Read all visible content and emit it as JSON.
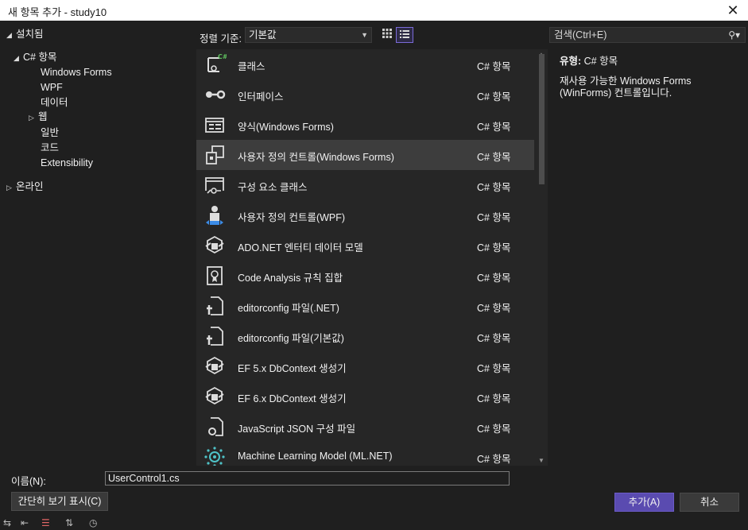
{
  "window": {
    "title": "새 항목 추가 - study10",
    "close_icon": "close-icon"
  },
  "tree": {
    "installed": "설치됨",
    "csharp_items": "C# 항목",
    "children": [
      "Windows Forms",
      "WPF",
      "데이터",
      "웹",
      "일반",
      "코드",
      "Extensibility"
    ],
    "online": "온라인"
  },
  "sort": {
    "label": "정렬 기준:",
    "value": "기본값"
  },
  "search": {
    "placeholder": "검색(Ctrl+E)"
  },
  "templates": [
    {
      "name": "클래스",
      "type": "C# 항목",
      "icon": "class-icon"
    },
    {
      "name": "인터페이스",
      "type": "C# 항목",
      "icon": "interface-icon"
    },
    {
      "name": "양식(Windows Forms)",
      "type": "C# 항목",
      "icon": "form-icon"
    },
    {
      "name": "사용자 정의 컨트롤(Windows Forms)",
      "type": "C# 항목",
      "icon": "user-control-icon"
    },
    {
      "name": "구성 요소 클래스",
      "type": "C# 항목",
      "icon": "component-class-icon"
    },
    {
      "name": "사용자 정의 컨트롤(WPF)",
      "type": "C# 항목",
      "icon": "wpf-user-control-icon"
    },
    {
      "name": "ADO.NET 엔터티 데이터 모델",
      "type": "C# 항목",
      "icon": "entity-model-icon"
    },
    {
      "name": "Code Analysis 규칙 집합",
      "type": "C# 항목",
      "icon": "ruleset-icon"
    },
    {
      "name": "editorconfig 파일(.NET)",
      "type": "C# 항목",
      "icon": "editorconfig-icon"
    },
    {
      "name": "editorconfig 파일(기본값)",
      "type": "C# 항목",
      "icon": "editorconfig-icon"
    },
    {
      "name": "EF 5.x DbContext 생성기",
      "type": "C# 항목",
      "icon": "dbcontext-generator-icon"
    },
    {
      "name": "EF 6.x DbContext 생성기",
      "type": "C# 항목",
      "icon": "dbcontext-generator-icon"
    },
    {
      "name": "JavaScript JSON 구성 파일",
      "type": "C# 항목",
      "icon": "json-config-icon"
    },
    {
      "name": "Machine Learning Model (ML.NET)",
      "type": "C# 항목",
      "icon": "ml-model-icon"
    }
  ],
  "details": {
    "type_label": "유형:",
    "type_value": "C# 항목",
    "description": "재사용 가능한 Windows Forms (WinForms) 컨트롤입니다."
  },
  "name_field": {
    "label": "이름(N):",
    "value": "UserControl1.cs"
  },
  "buttons": {
    "compact": "간단히 보기 표시(C)",
    "add": "추가(A)",
    "cancel": "취소"
  },
  "colors": {
    "accent": "#5a4bb0",
    "background": "#1f1f1f",
    "list_bg": "#262626",
    "selected": "#3d3d3d"
  }
}
